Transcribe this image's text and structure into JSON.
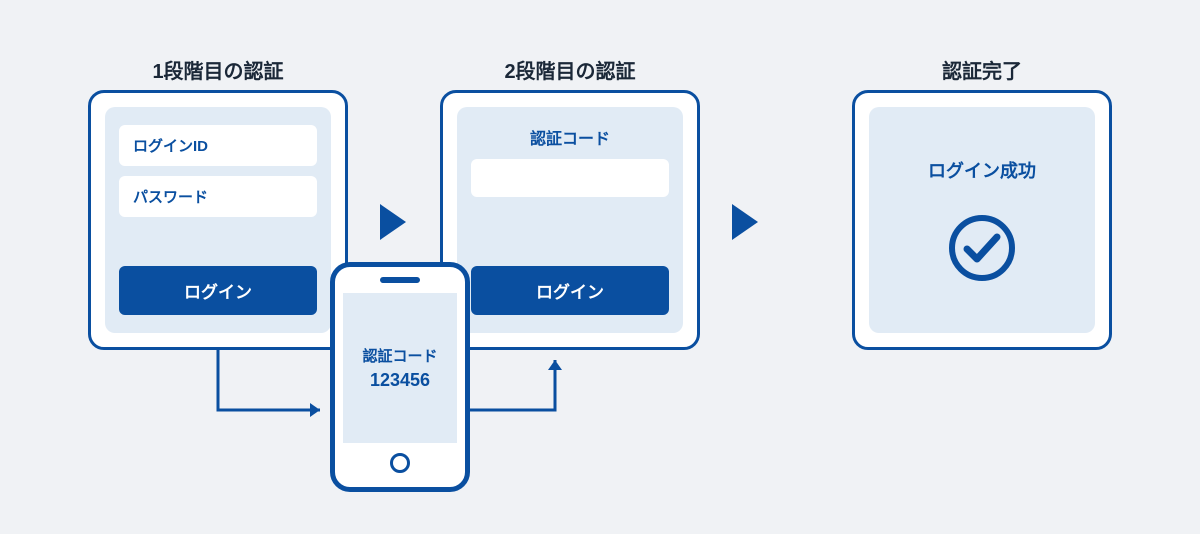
{
  "stage1": {
    "title": "1段階目の認証",
    "loginIdPlaceholder": "ログインID",
    "passwordPlaceholder": "パスワード",
    "loginButtonLabel": "ログイン"
  },
  "stage2": {
    "title": "2段階目の認証",
    "codeLabel": "認証コード",
    "loginButtonLabel": "ログイン"
  },
  "stage3": {
    "title": "認証完了",
    "successLabel": "ログイン成功"
  },
  "phone": {
    "codeLabel": "認証コード",
    "codeValue": "123456"
  },
  "colors": {
    "primary": "#0a4fa0",
    "panelBg": "#e1ebf5",
    "pageBg": "#f0f2f5"
  }
}
